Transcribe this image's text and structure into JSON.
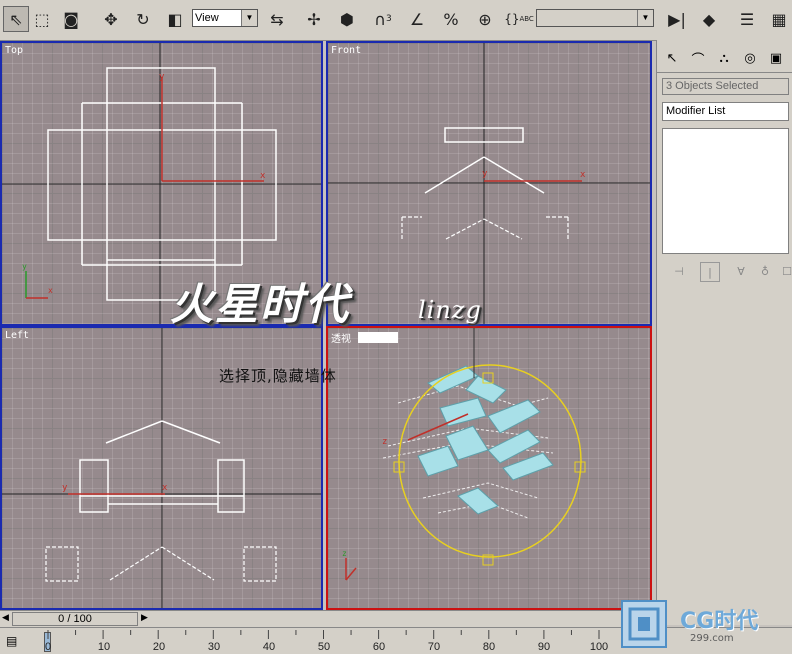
{
  "toolbar": {
    "reference_coord": "View",
    "tools": [
      {
        "name": "select-object-icon",
        "glyph": "⇖"
      },
      {
        "name": "select-region-icon",
        "glyph": "⬚"
      },
      {
        "name": "window-crossing-icon",
        "glyph": "◙"
      },
      {
        "name": "move-icon",
        "glyph": "✥"
      },
      {
        "name": "rotate-icon",
        "glyph": "↻"
      },
      {
        "name": "scale-icon",
        "glyph": "◧"
      },
      {
        "name": "mirror-icon",
        "glyph": "⇆"
      },
      {
        "name": "pivot-icon",
        "glyph": "✢"
      },
      {
        "name": "box-icon",
        "glyph": "⬢"
      },
      {
        "name": "snap-3d-icon",
        "glyph": "∩"
      },
      {
        "name": "angle-snap-icon",
        "glyph": "∠"
      },
      {
        "name": "percent-snap-icon",
        "glyph": "%"
      },
      {
        "name": "spinner-snap-icon",
        "glyph": "⊕"
      },
      {
        "name": "edit-named-selection-icon",
        "glyph": "{}"
      },
      {
        "name": "mirror-tool-icon",
        "glyph": "▶|"
      },
      {
        "name": "align-icon",
        "glyph": "◆"
      },
      {
        "name": "layers-icon",
        "glyph": "☰"
      },
      {
        "name": "curve-editor-icon",
        "glyph": "▦"
      }
    ],
    "snap_label": "3",
    "abc_label": "ABC"
  },
  "viewports": {
    "top": {
      "label": "Top"
    },
    "front": {
      "label": "Front"
    },
    "left": {
      "label": "Left"
    },
    "perspective": {
      "label": "透视"
    }
  },
  "axis": {
    "x": "x",
    "y": "y",
    "z": "z"
  },
  "command_panel": {
    "tabs": [
      "create-tab-icon",
      "modify-tab-icon",
      "hierarchy-tab-icon",
      "motion-tab-icon",
      "display-tab-icon"
    ],
    "selection_field": "3 Objects Selected",
    "modifier_list": "Modifier List"
  },
  "timeline": {
    "slider_label": "0 / 100",
    "ticks": [
      "0",
      "10",
      "20",
      "30",
      "40",
      "50",
      "60",
      "70",
      "80",
      "90",
      "100"
    ]
  },
  "overlay": {
    "watermark": "火星时代",
    "watermark_sub": "linzg",
    "caption": "选择顶,隐藏墙体",
    "logo_text": "CG时代",
    "logo_url": "299.com"
  },
  "colors": {
    "viewport_bg": "#968a8d",
    "active_border": "#cc1111",
    "inactive_border": "#1a2ab0",
    "axis_red": "#c0302a",
    "selection_yellow": "#e8d020",
    "roof_cyan": "#a8e0e8"
  }
}
